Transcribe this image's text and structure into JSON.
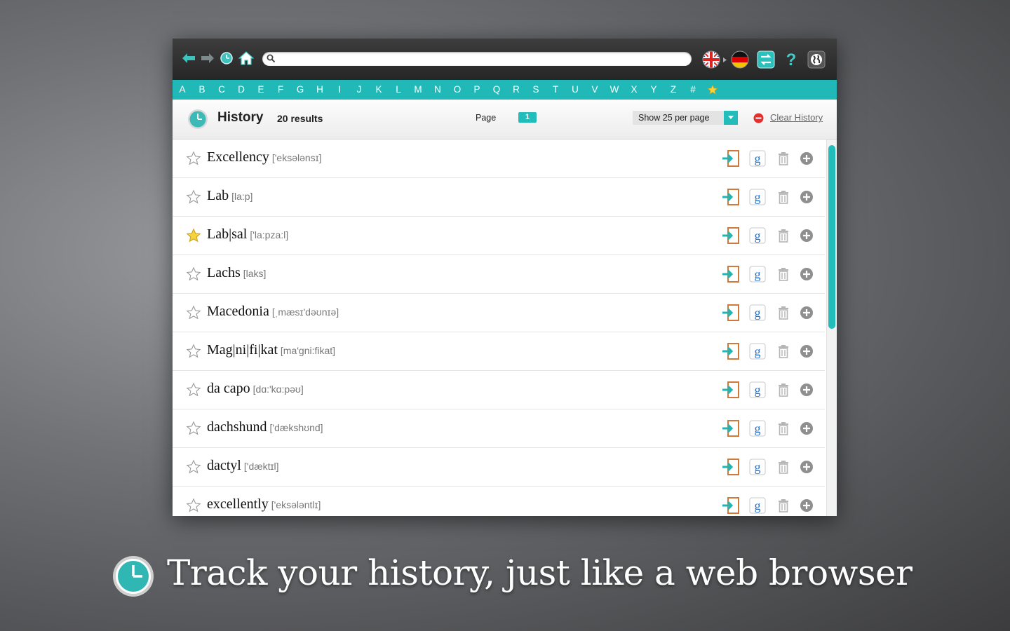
{
  "toolbar": {
    "search": {
      "value": "",
      "placeholder": ""
    },
    "icons": [
      "back-arrow-icon",
      "forward-arrow-icon",
      "history-clock-icon",
      "home-icon",
      "search-icon",
      "uk-flag-icon",
      "german-flag-icon",
      "swap-languages-icon",
      "help-icon",
      "web-globe-icon"
    ],
    "colors": {
      "accent": "#21b9b7",
      "toolbar": "#2e2e2e"
    }
  },
  "alphabet": [
    "A",
    "B",
    "C",
    "D",
    "E",
    "F",
    "G",
    "H",
    "I",
    "J",
    "K",
    "L",
    "M",
    "N",
    "O",
    "P",
    "Q",
    "R",
    "S",
    "T",
    "U",
    "V",
    "W",
    "X",
    "Y",
    "Z",
    "#",
    "★"
  ],
  "header": {
    "title": "History",
    "results": "20 results",
    "page_label": "Page",
    "page_number": "1",
    "per_page": "Show 25 per page",
    "clear_history": "Clear History"
  },
  "entries": [
    {
      "word": "Excellency",
      "pron": "['eksələnsɪ]",
      "starred": false
    },
    {
      "word": "Lab",
      "pron": "[la:p]",
      "starred": false
    },
    {
      "word": "Lab|sal",
      "pron": "['la:pza:l]",
      "starred": true
    },
    {
      "word": "Lachs",
      "pron": "[laks]",
      "starred": false
    },
    {
      "word": "Macedonia",
      "pron": "[ˌmæsɪ'dəʊnɪə]",
      "starred": false
    },
    {
      "word": "Mag|ni|fi|kat",
      "pron": "[ma'gni:fikat]",
      "starred": false
    },
    {
      "word": "da capo",
      "pron": "[dɑ:'kɑ:pəʊ]",
      "starred": false
    },
    {
      "word": "dachshund",
      "pron": "['dækshʊnd]",
      "starred": false
    },
    {
      "word": "dactyl",
      "pron": "['dæktɪl]",
      "starred": false
    },
    {
      "word": "excellently",
      "pron": "['eksələntlɪ]",
      "starred": false
    }
  ],
  "row_actions": [
    "open-entry-icon",
    "google-search-icon",
    "trash-icon",
    "add-icon"
  ],
  "caption": "Track your history, just like a web browser"
}
